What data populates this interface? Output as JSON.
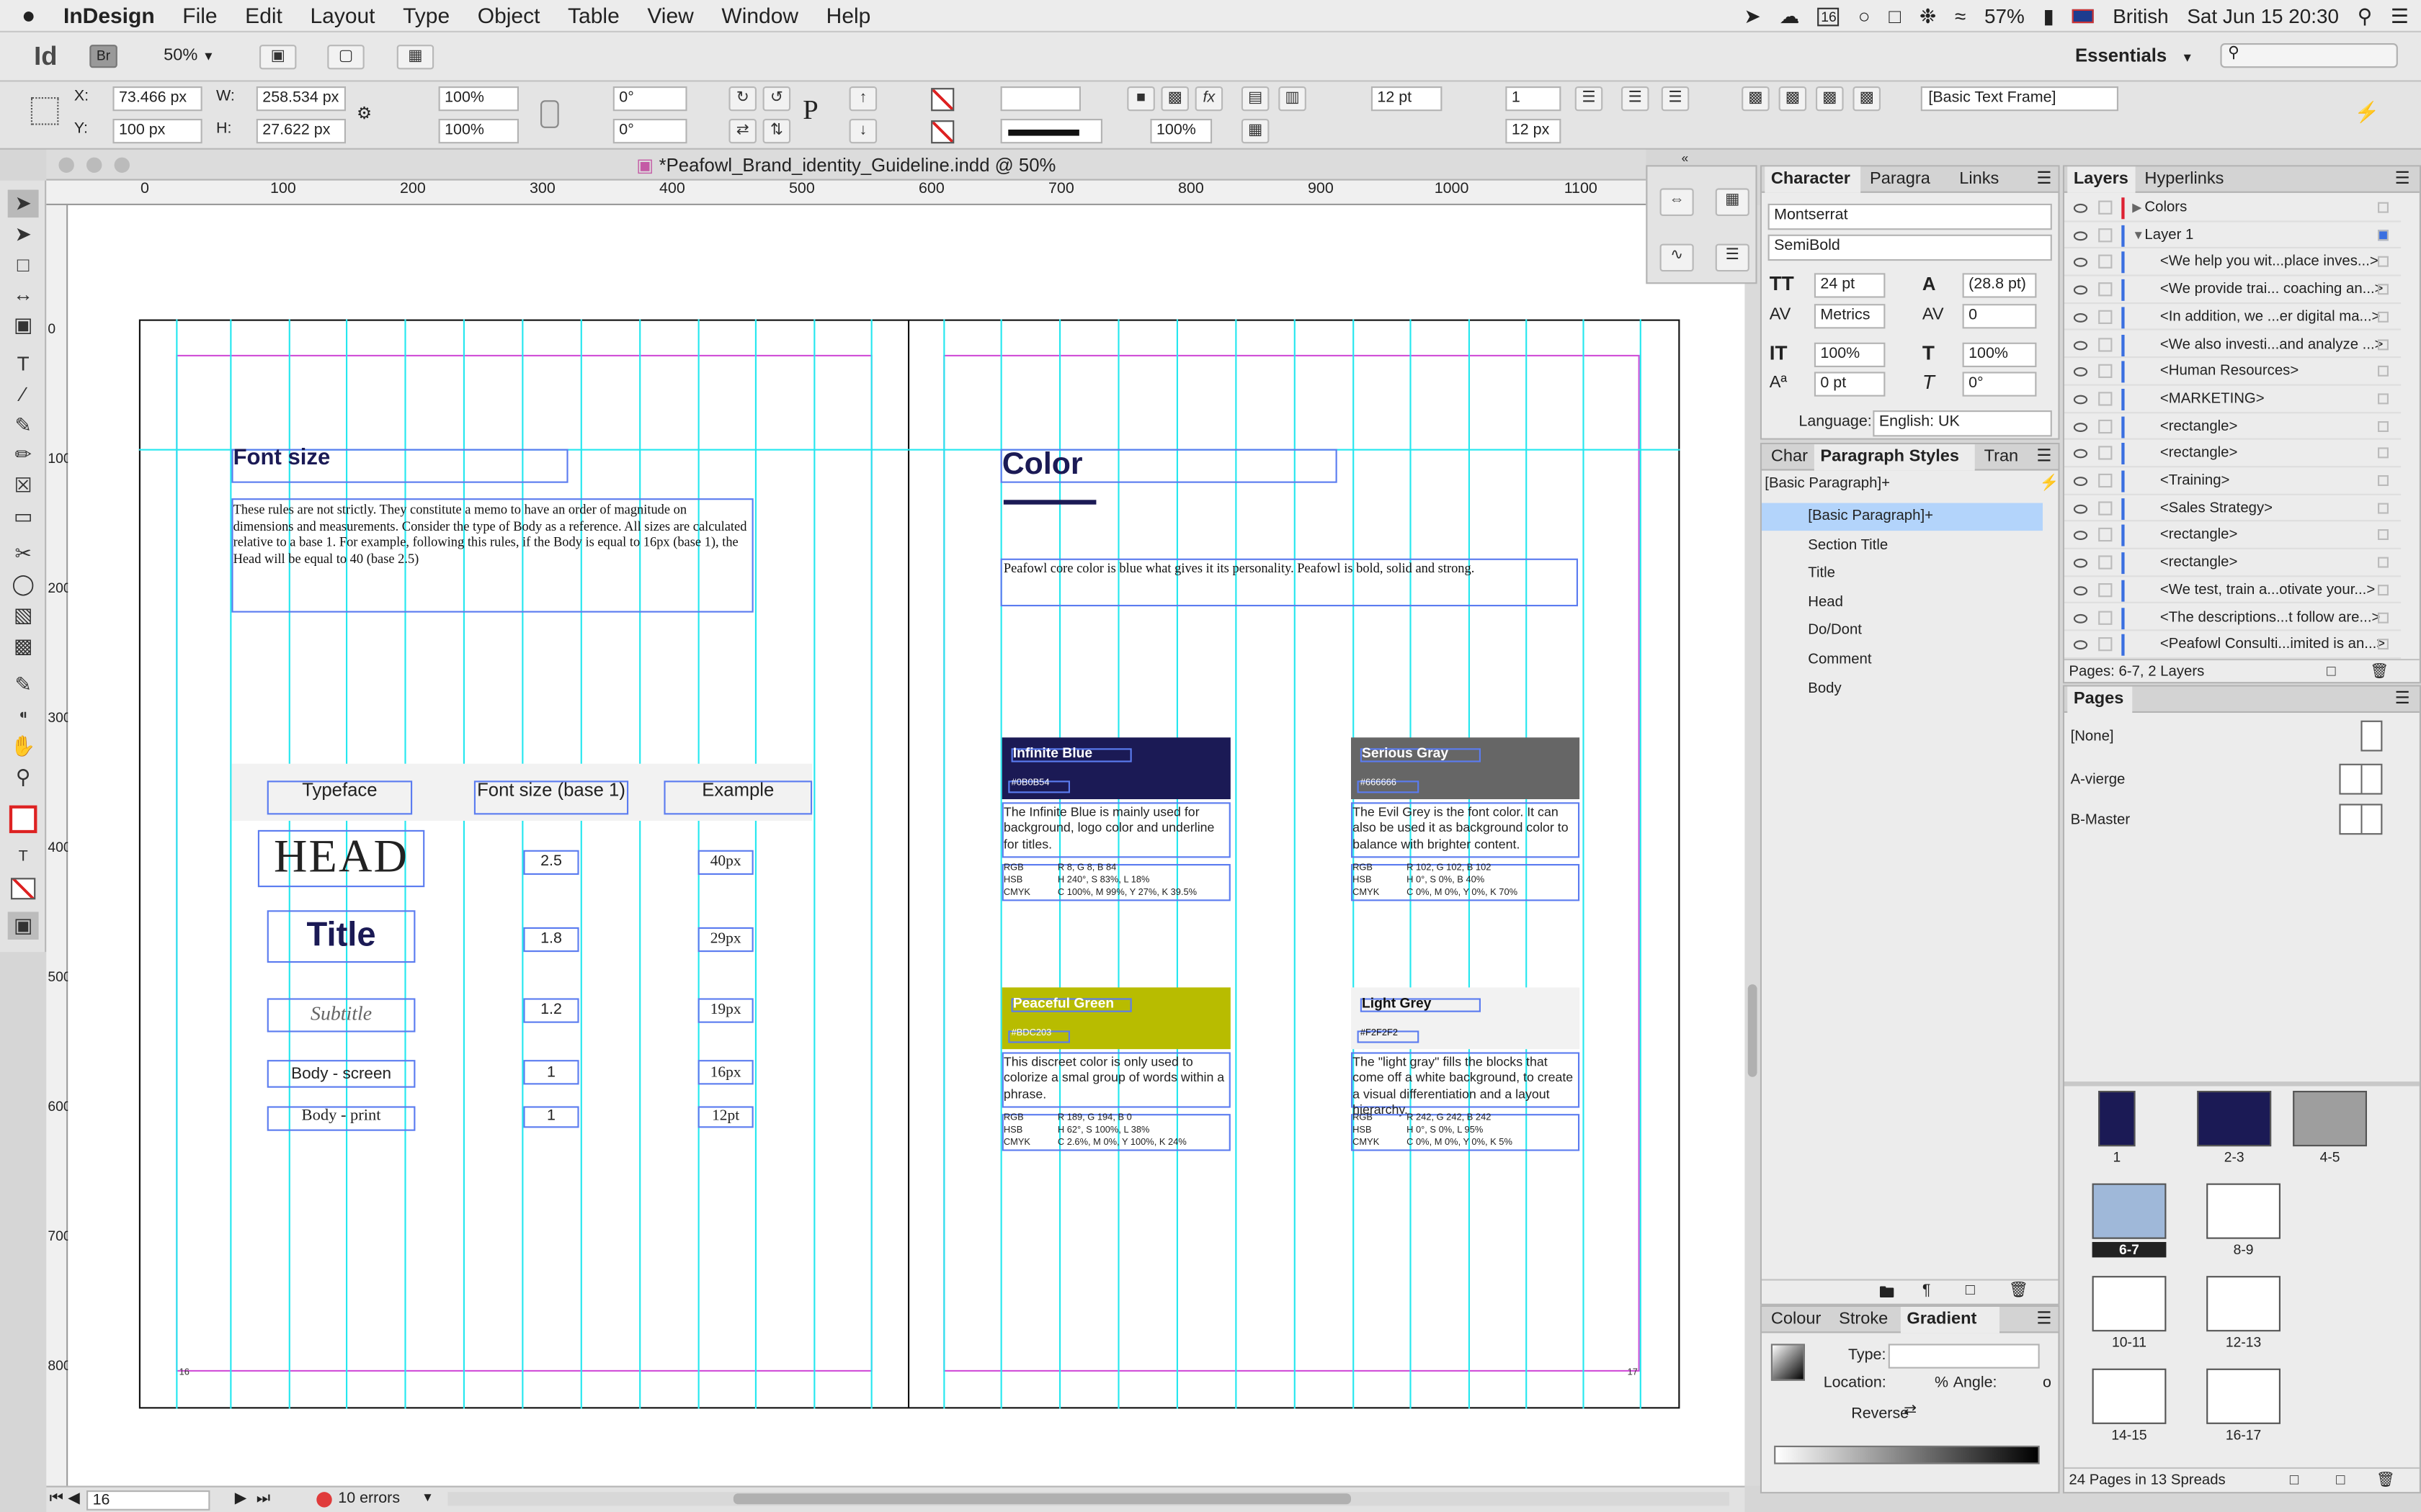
{
  "menubar": {
    "apple": "",
    "app": "InDesign",
    "items": [
      "File",
      "Edit",
      "Layout",
      "Type",
      "Object",
      "Table",
      "View",
      "Window",
      "Help"
    ],
    "battery": "57%",
    "language": "British",
    "clock": "Sat Jun 15  20:30",
    "calendar_day": "16"
  },
  "appbar": {
    "logo": "Id",
    "bridge": "Br",
    "zoom": "50%",
    "workspace": "Essentials",
    "search_placeholder": ""
  },
  "control": {
    "x_label": "X:",
    "x_value": "73.466 px",
    "y_label": "Y:",
    "y_value": "100 px",
    "w_label": "W:",
    "w_value": "258.534 px",
    "h_label": "H:",
    "h_value": "27.622 px",
    "scale_x": "100%",
    "scale_y": "100%",
    "rotate": "0°",
    "shear": "0°",
    "stroke_weight": "",
    "opacity": "100%",
    "gutter_a": "12 pt",
    "cols": "1",
    "gutter_b": "12 px",
    "frame_style": "[Basic Text Frame]"
  },
  "document": {
    "title": "*Peafowl_Brand_identity_Guideline.indd @ 50%",
    "ruler_h": [
      "0",
      "100",
      "200",
      "300",
      "400",
      "500",
      "600",
      "700",
      "800",
      "900",
      "1000",
      "1100"
    ],
    "ruler_v": [
      "0",
      "100",
      "200",
      "300",
      "400",
      "500",
      "600",
      "700",
      "800"
    ],
    "page_number_left": "16",
    "page_number_right": "17"
  },
  "left_page": {
    "heading": "Font size",
    "body": "These rules are not strictly. They constitute a memo to have an order of magnitude on dimensions and measurements. Consider the type of Body as a reference. All sizes are calculated relative to a base 1. For example, following this rules, if the Body is equal to 16px (base 1), the Head will be equal to 40 (base 2.5)",
    "table_headers": [
      "Typeface",
      "Font size (base 1)",
      "Example"
    ],
    "table_rows": [
      {
        "typeface": "HEAD",
        "base": "2.5",
        "example": "40px"
      },
      {
        "typeface": "Title",
        "base": "1.8",
        "example": "29px"
      },
      {
        "typeface": "Subtitle",
        "base": "1.2",
        "example": "19px"
      },
      {
        "typeface": "Body - screen",
        "base": "1",
        "example": "16px"
      },
      {
        "typeface": "Body - print",
        "base": "1",
        "example": "12pt"
      }
    ]
  },
  "right_page": {
    "heading": "Color",
    "intro": "Peafowl core color is blue what gives it its personality. Peafowl is bold, solid and strong.",
    "swatches": [
      {
        "name": "Infinite Blue",
        "hex": "#0B0B54",
        "color": "#1b1a55",
        "text_color": "#ffffff",
        "desc": "The Infinite Blue is mainly used for background, logo color and underline for titles.",
        "rgb": "R 8, G 8, B 84",
        "hsb": "H 240°, S 83%, L 18%",
        "cmyk": "C 100%, M 99%, Y 27%, K 39.5%"
      },
      {
        "name": "Serious Gray",
        "hex": "#666666",
        "color": "#666666",
        "text_color": "#ffffff",
        "desc": "The Evil Grey is the font color. It can also be used it as background color to balance with brighter content.",
        "rgb": "R 102, G 102, B 102",
        "hsb": "H 0°, S 0%, B 40%",
        "cmyk": "C 0%, M 0%, Y 0%, K 70%"
      },
      {
        "name": "Peaceful Green",
        "hex": "#BDC203",
        "color": "#b8bc00",
        "text_color": "#ffffff",
        "desc": "This discreet color is only used to colorize a smal group of words within a phrase.",
        "rgb": "R 189, G 194, B 0",
        "hsb": "H 62°, S 100%, L 38%",
        "cmyk": "C 2.6%, M 0%, Y 100%, K 24%"
      },
      {
        "name": "Light Grey",
        "hex": "#F2F2F2",
        "color": "#f2f2f2",
        "text_color": "#111111",
        "desc": "The \"light gray\" fills the blocks that come off a white background, to create a visual differentiation and a layout hierarchy.",
        "rgb": "R 242, G 242, B 242",
        "hsb": "H 0°, S 0%, L 95%",
        "cmyk": "C 0%, M 0%, Y 0%, K 5%"
      }
    ],
    "labels": {
      "rgb": "RGB",
      "hsb": "HSB",
      "cmyk": "CMYK"
    }
  },
  "character_panel": {
    "tabs": [
      "Character",
      "Paragra",
      "Links"
    ],
    "font": "Montserrat",
    "style": "SemiBold",
    "size": "24 pt",
    "leading": "(28.8 pt)",
    "kerning": "Metrics",
    "tracking": "0",
    "vscale": "100%",
    "hscale": "100%",
    "baseline": "0 pt",
    "skew": "0°",
    "language_label": "Language:",
    "language": "English: UK"
  },
  "paragraph_styles": {
    "tabs": [
      "Char",
      "Paragraph Styles",
      "Tran"
    ],
    "current": "[Basic Paragraph]+",
    "items": [
      "[Basic Paragraph]+",
      "Section Title",
      "Title",
      "Head",
      "Do/Dont",
      "Comment",
      "Body"
    ]
  },
  "gradient_panel": {
    "tabs": [
      "Colour",
      "Stroke",
      "Gradient"
    ],
    "type_label": "Type:",
    "location_label": "Location:",
    "percent": "%",
    "angle_label": "Angle:",
    "angle_unit": "o",
    "reverse_label": "Reverse"
  },
  "layers_panel": {
    "tabs": [
      "Layers",
      "Hyperlinks"
    ],
    "items": [
      "Colors",
      "Layer 1",
      "<We help you wit...place inves...>",
      "<We provide trai... coaching an...>",
      "<In addition, we ...er digital ma...>",
      "<We also investi...and analyze ...>",
      "<Human Resources>",
      "<MARKETING>",
      "<rectangle>",
      "<rectangle>",
      "<Training>",
      "<Sales Strategy>",
      "<rectangle>",
      "<rectangle>",
      "<We test, train a...otivate your...>",
      "<The descriptions...t follow are...>",
      "<Peafowl Consulti...imited is an...>"
    ],
    "footer": "Pages: 6-7, 2 Layers"
  },
  "pages_panel": {
    "tab": "Pages",
    "masters": [
      "[None]",
      "A-vierge",
      "B-Master"
    ],
    "spreads": [
      "1",
      "2-3",
      "4-5",
      "6-7",
      "8-9",
      "10-11",
      "12-13",
      "14-15",
      "16-17"
    ],
    "footer": "24 Pages in 13 Spreads"
  },
  "statusbar": {
    "page": "16",
    "errors": "10 errors"
  },
  "colors": {
    "guide": "#25e7ef",
    "margin": "#d14fd8",
    "frame": "#5b7cf0",
    "navy": "#1b1a55",
    "selection": "#b3d4fb"
  }
}
